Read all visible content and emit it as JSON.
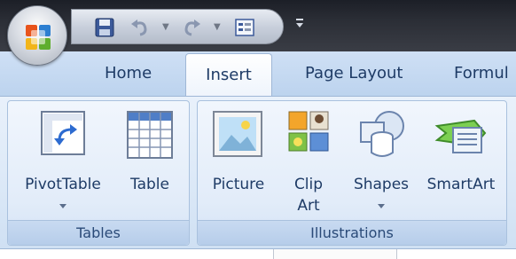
{
  "quick_access": {
    "save_icon": "floppy-disk-icon",
    "undo_icon": "undo-arrow-icon",
    "redo_icon": "redo-arrow-icon",
    "form_icon": "form-icon",
    "customize_icon": "dropdown-arrow-icon"
  },
  "office_button": {
    "icon": "office-logo-icon"
  },
  "tabs": [
    {
      "label": "Home"
    },
    {
      "label": "Insert"
    },
    {
      "label": "Page Layout"
    },
    {
      "label": "Formul"
    }
  ],
  "groups": {
    "tables": {
      "label": "Tables",
      "commands": [
        {
          "label": "PivotTable",
          "icon": "pivot-table-icon"
        },
        {
          "label": "Table",
          "icon": "table-grid-icon"
        }
      ]
    },
    "illustrations": {
      "label": "Illustrations",
      "commands": [
        {
          "label": "Picture",
          "icon": "picture-icon"
        },
        {
          "label_line1": "Clip",
          "label_line2": "Art",
          "icon": "clip-art-icon"
        },
        {
          "label": "Shapes",
          "icon": "shapes-icon"
        },
        {
          "label": "SmartArt",
          "icon": "smartart-icon"
        }
      ]
    }
  },
  "colors": {
    "accent": "#1e3b66",
    "ribbon_bg": "#dbe8f7",
    "titlebar_bg": "#2b2e36"
  }
}
